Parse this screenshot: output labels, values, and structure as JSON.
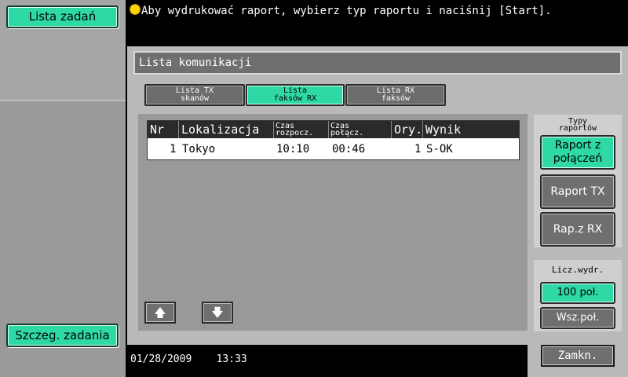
{
  "left": {
    "job_list": "Lista zadań",
    "job_details": "Szczeg. zadania"
  },
  "message": "Aby wydrukować raport, wybierz typ raportu i naciśnij [Start].",
  "panel": {
    "title": "Lista komunikacji"
  },
  "tabs": [
    {
      "line1": "Lista TX",
      "line2": "skanów",
      "active": false
    },
    {
      "line1": "Lista",
      "line2": "faksów RX",
      "active": true
    },
    {
      "line1": "Lista RX",
      "line2": "faksów",
      "active": false
    }
  ],
  "table": {
    "headers": {
      "nr": "Nr",
      "location": "Lokalizacja",
      "start_1": "Czas",
      "start_2": "rozpocz.",
      "conn_1": "Czas",
      "conn_2": "połącz.",
      "orig": "Ory.",
      "result": "Wynik"
    },
    "rows": [
      {
        "nr": "1",
        "location": "Tokyo",
        "start": "10:10",
        "conn": "00:46",
        "orig": "1",
        "result": "S-OK"
      }
    ]
  },
  "right": {
    "report_types_1": "Typy",
    "report_types_2": "raportów",
    "btn_conn_report_1": "Raport z",
    "btn_conn_report_2": "połączeń",
    "btn_tx_report": "Raport TX",
    "btn_rx_report": "Rap.z RX",
    "copies_label": "Licz.wydr.",
    "btn_100": "100 poł.",
    "btn_all": "Wsz.poł."
  },
  "footer": {
    "date": "01/28/2009",
    "time": "13:33",
    "close": "Zamkn."
  }
}
